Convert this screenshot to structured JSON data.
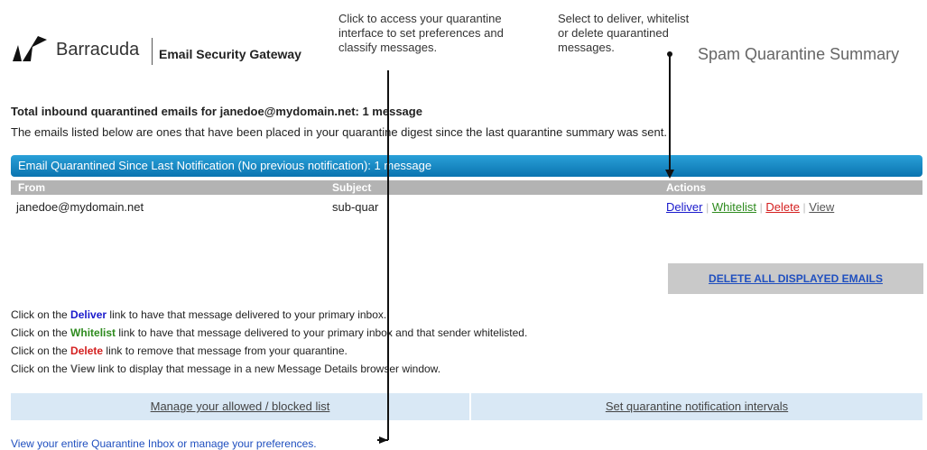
{
  "header": {
    "brand": "Barracuda",
    "product": "Email Security Gateway",
    "page_title": "Spam Quarantine Summary"
  },
  "callouts": {
    "quarantine_interface": "Click to access your quarantine\ninterface to set preferences and\nclassify messages.",
    "actions": "Select to deliver, whitelist\nor delete quarantined\nmessages."
  },
  "summary": {
    "total": "Total inbound quarantined emails for janedoe@mydomain.net: 1 message",
    "description": "The emails listed below are ones that have been placed in your quarantine digest since the last quarantine summary was sent."
  },
  "table": {
    "title": "Email Quarantined Since Last Notification (No previous notification): 1 message",
    "columns": [
      "From",
      "Subject",
      "Actions"
    ],
    "rows": [
      {
        "from": "janedoe@mydomain.net",
        "subject": "sub-quar"
      }
    ],
    "actions": [
      "Deliver",
      "Whitelist",
      "Delete",
      "View"
    ],
    "separator": "|",
    "delete_all": "DELETE ALL DISPLAYED EMAILS"
  },
  "instructions": [
    {
      "prefix": "Click on the ",
      "keyword": "Deliver",
      "suffix": " link to have that message delivered to your primary inbox."
    },
    {
      "prefix": "Click on the ",
      "keyword": "Whitelist",
      "suffix": " link to have that message delivered to your primary inbox and that sender whitelisted."
    },
    {
      "prefix": "Click on the ",
      "keyword": "Delete",
      "suffix": " link to remove that message from your quarantine."
    },
    {
      "prefix": "Click on the ",
      "keyword": "View",
      "suffix": " link to display that message in a new Message Details browser window."
    }
  ],
  "footer": {
    "allowed_blocked": "Manage your allowed / blocked list",
    "notification_intervals": "Set quarantine notification intervals",
    "view_inbox": "View your entire Quarantine Inbox or manage your preferences."
  },
  "colors": {
    "deliver": "#1a1acc",
    "whitelist": "#2e8b1e",
    "delete": "#d42020",
    "view": "#555555",
    "bar_blue": "#0a74b0"
  },
  "icons": {
    "logo": "barracuda-logo-icon"
  }
}
